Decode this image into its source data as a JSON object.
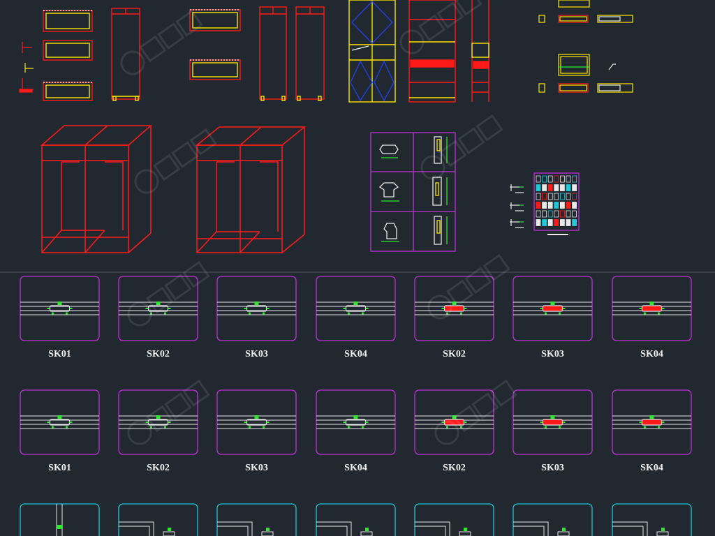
{
  "canvas": {
    "background": "#212830",
    "divider_color": "#4a5660"
  },
  "colors": {
    "red": "#ff1a1a",
    "yellow": "#ffe600",
    "gold": "#c8a020",
    "orange": "#ff8a00",
    "magenta": "#c030d8",
    "cyan": "#20c8d8",
    "white": "#e8e8e8",
    "green": "#2ee82e",
    "blue": "#2040e0",
    "label": "#f0f0f0"
  },
  "sections": {
    "top": {
      "description": "cabinet elevations, sections and isometric views"
    },
    "row1": {
      "labels": [
        "SK01",
        "SK02",
        "SK03",
        "SK04",
        "SK02",
        "SK03",
        "SK04"
      ],
      "red_joint": [
        false,
        false,
        false,
        false,
        true,
        true,
        true
      ]
    },
    "row2": {
      "labels": [
        "SK01",
        "SK02",
        "SK03",
        "SK04",
        "SK02",
        "SK03",
        "SK04"
      ],
      "red_joint": [
        false,
        false,
        false,
        false,
        true,
        true,
        true
      ]
    },
    "row3": {
      "count": 7
    }
  },
  "watermark": {
    "icon": "logo-watermark-icon"
  }
}
